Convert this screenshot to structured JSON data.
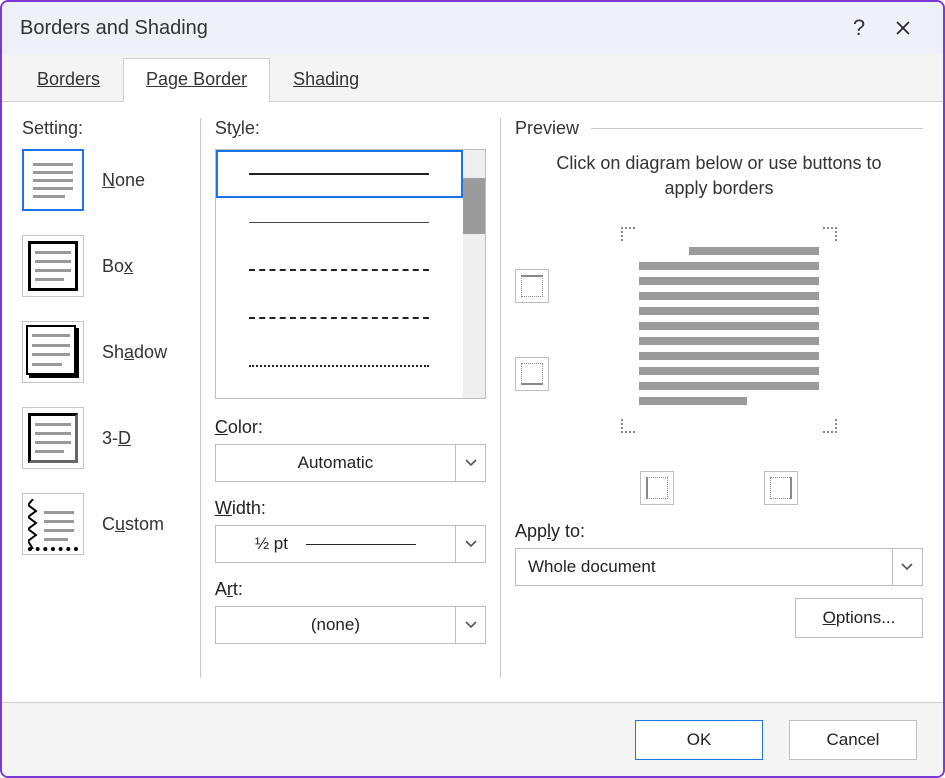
{
  "title": "Borders and Shading",
  "tabs": {
    "borders": "Borders",
    "page_border": "Page Border",
    "shading": "Shading"
  },
  "setting": {
    "label": "Setting:",
    "none": "None",
    "box": "Box",
    "shadow": "Shadow",
    "threed": "3-D",
    "custom": "Custom"
  },
  "style": {
    "label": "Style:"
  },
  "color": {
    "label": "Color:",
    "value": "Automatic"
  },
  "width": {
    "label": "Width:",
    "value": "½ pt"
  },
  "art": {
    "label": "Art:",
    "value": "(none)"
  },
  "preview": {
    "label": "Preview",
    "hint": "Click on diagram below or use buttons to apply borders"
  },
  "apply": {
    "label": "Apply to:",
    "value": "Whole document"
  },
  "actions": {
    "options": "Options...",
    "ok": "OK",
    "cancel": "Cancel"
  }
}
